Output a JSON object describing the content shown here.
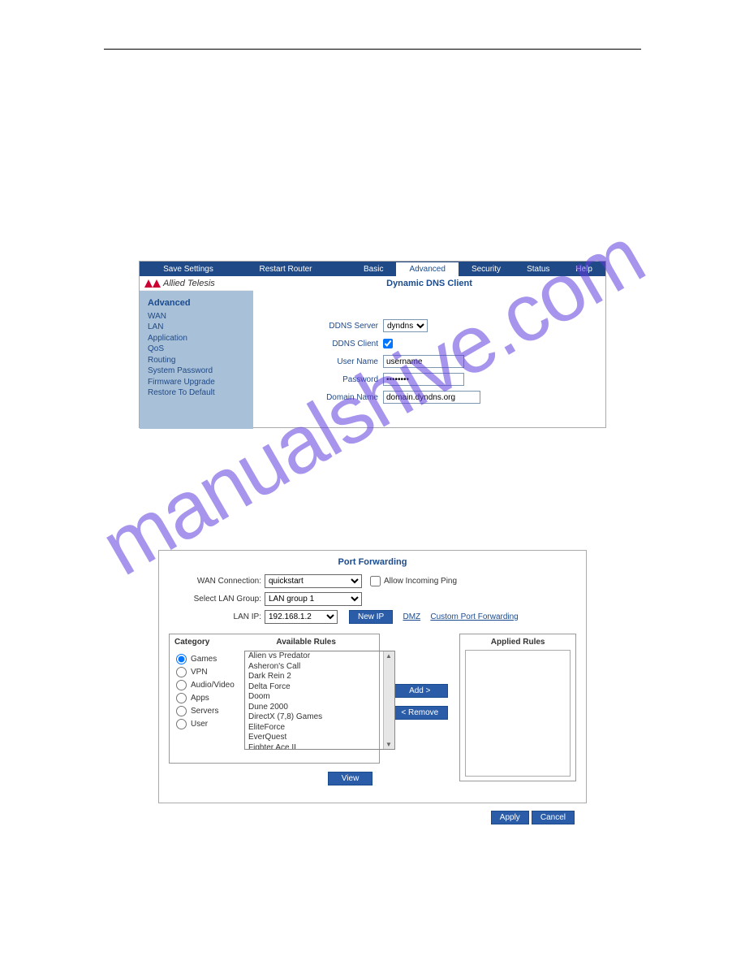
{
  "watermark": "manualshive.com",
  "fig1": {
    "menu": {
      "save": "Save Settings",
      "restart": "Restart Router"
    },
    "tabs": [
      "Basic",
      "Advanced",
      "Security",
      "Status",
      "Help"
    ],
    "active_tab": "Advanced",
    "brand": "Allied Telesis",
    "page_title": "Dynamic DNS Client",
    "sidebar": {
      "heading": "Advanced",
      "items": [
        "WAN",
        "LAN",
        "Application",
        "QoS",
        "Routing",
        "System Password",
        "Firmware Upgrade",
        "Restore To Default"
      ]
    },
    "form": {
      "ddns_server_label": "DDNS Server",
      "ddns_server_value": "dyndns",
      "ddns_client_label": "DDNS Client",
      "ddns_client_checked": true,
      "username_label": "User Name",
      "username_value": "username",
      "password_label": "Password",
      "password_value": "••••••••",
      "domain_label": "Domain Name",
      "domain_value": "domain.dyndns.org"
    }
  },
  "fig2": {
    "title": "Port Forwarding",
    "wan_label": "WAN Connection:",
    "wan_value": "quickstart",
    "allow_ping": "Allow Incoming Ping",
    "lan_group_label": "Select LAN Group:",
    "lan_group_value": "LAN group 1",
    "lan_ip_label": "LAN IP:",
    "lan_ip_value": "192.168.1.2",
    "new_ip": "New IP",
    "dmz": "DMZ",
    "custom": "Custom Port Forwarding",
    "category_hd": "Category",
    "available_hd": "Available Rules",
    "applied_hd": "Applied Rules",
    "categories": [
      "Games",
      "VPN",
      "Audio/Video",
      "Apps",
      "Servers",
      "User"
    ],
    "selected_category": "Games",
    "rules": [
      "Alien vs Predator",
      "Asheron's Call",
      "Dark Rein 2",
      "Delta Force",
      "Doom",
      "Dune 2000",
      "DirectX (7,8) Games",
      "EliteForce",
      "EverQuest",
      "Fighter Ace II"
    ],
    "btn_add": "Add >",
    "btn_remove": "< Remove",
    "btn_view": "View",
    "btn_apply": "Apply",
    "btn_cancel": "Cancel"
  }
}
